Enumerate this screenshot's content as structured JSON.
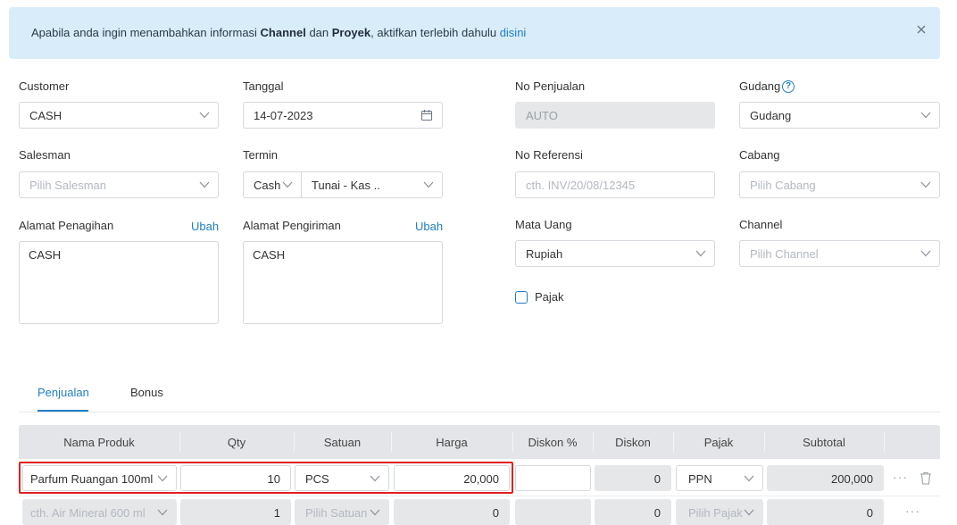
{
  "alert": {
    "prefix": "Apabila anda ingin menambahkan informasi ",
    "channel": "Channel",
    "dan": " dan ",
    "proyek": "Proyek",
    "suffix": ", aktifkan terlebih dahulu ",
    "link": "disini"
  },
  "form": {
    "customer": {
      "label": "Customer",
      "value": "CASH"
    },
    "tanggal": {
      "label": "Tanggal",
      "value": "14-07-2023"
    },
    "no_penjualan": {
      "label": "No Penjualan",
      "value": "AUTO"
    },
    "gudang": {
      "label": "Gudang",
      "value": "Gudang",
      "help": "?"
    },
    "salesman": {
      "label": "Salesman",
      "placeholder": "Pilih Salesman"
    },
    "termin": {
      "label": "Termin",
      "type": "Cash",
      "value": "Tunai - Kas .."
    },
    "no_referensi": {
      "label": "No Referensi",
      "placeholder": "cth. INV/20/08/12345"
    },
    "cabang": {
      "label": "Cabang",
      "placeholder": "Pilih Cabang"
    },
    "alamat_penagihan": {
      "label": "Alamat Penagihan",
      "action": "Ubah",
      "value": "CASH"
    },
    "alamat_pengiriman": {
      "label": "Alamat Pengiriman",
      "action": "Ubah",
      "value": "CASH"
    },
    "mata_uang": {
      "label": "Mata Uang",
      "value": "Rupiah"
    },
    "channel": {
      "label": "Channel",
      "placeholder": "Pilih Channel"
    },
    "pajak": {
      "label": "Pajak",
      "checked": false
    }
  },
  "tabs": [
    {
      "label": "Penjualan",
      "active": true
    },
    {
      "label": "Bonus",
      "active": false
    }
  ],
  "table": {
    "headers": [
      "Nama Produk",
      "Qty",
      "Satuan",
      "Harga",
      "Diskon %",
      "Diskon",
      "Pajak",
      "Subtotal"
    ],
    "rows": [
      {
        "produk": "Parfum Ruangan 100ml",
        "qty": "10",
        "satuan": "PCS",
        "harga": "20,000",
        "diskon_pct": "",
        "diskon": "0",
        "pajak": "PPN",
        "subtotal": "200,000"
      },
      {
        "produk": "cth. Air Mineral 600 ml",
        "qty": "1",
        "satuan": "Pilih Satuan",
        "harga": "0",
        "diskon_pct": "",
        "diskon": "0",
        "pajak": "Pilih Pajak",
        "subtotal": "0"
      }
    ],
    "more_icon": "···"
  },
  "colors": {
    "accent": "#1f7fc7",
    "alert_bg": "#d9ecfa",
    "highlight": "#e02020"
  }
}
